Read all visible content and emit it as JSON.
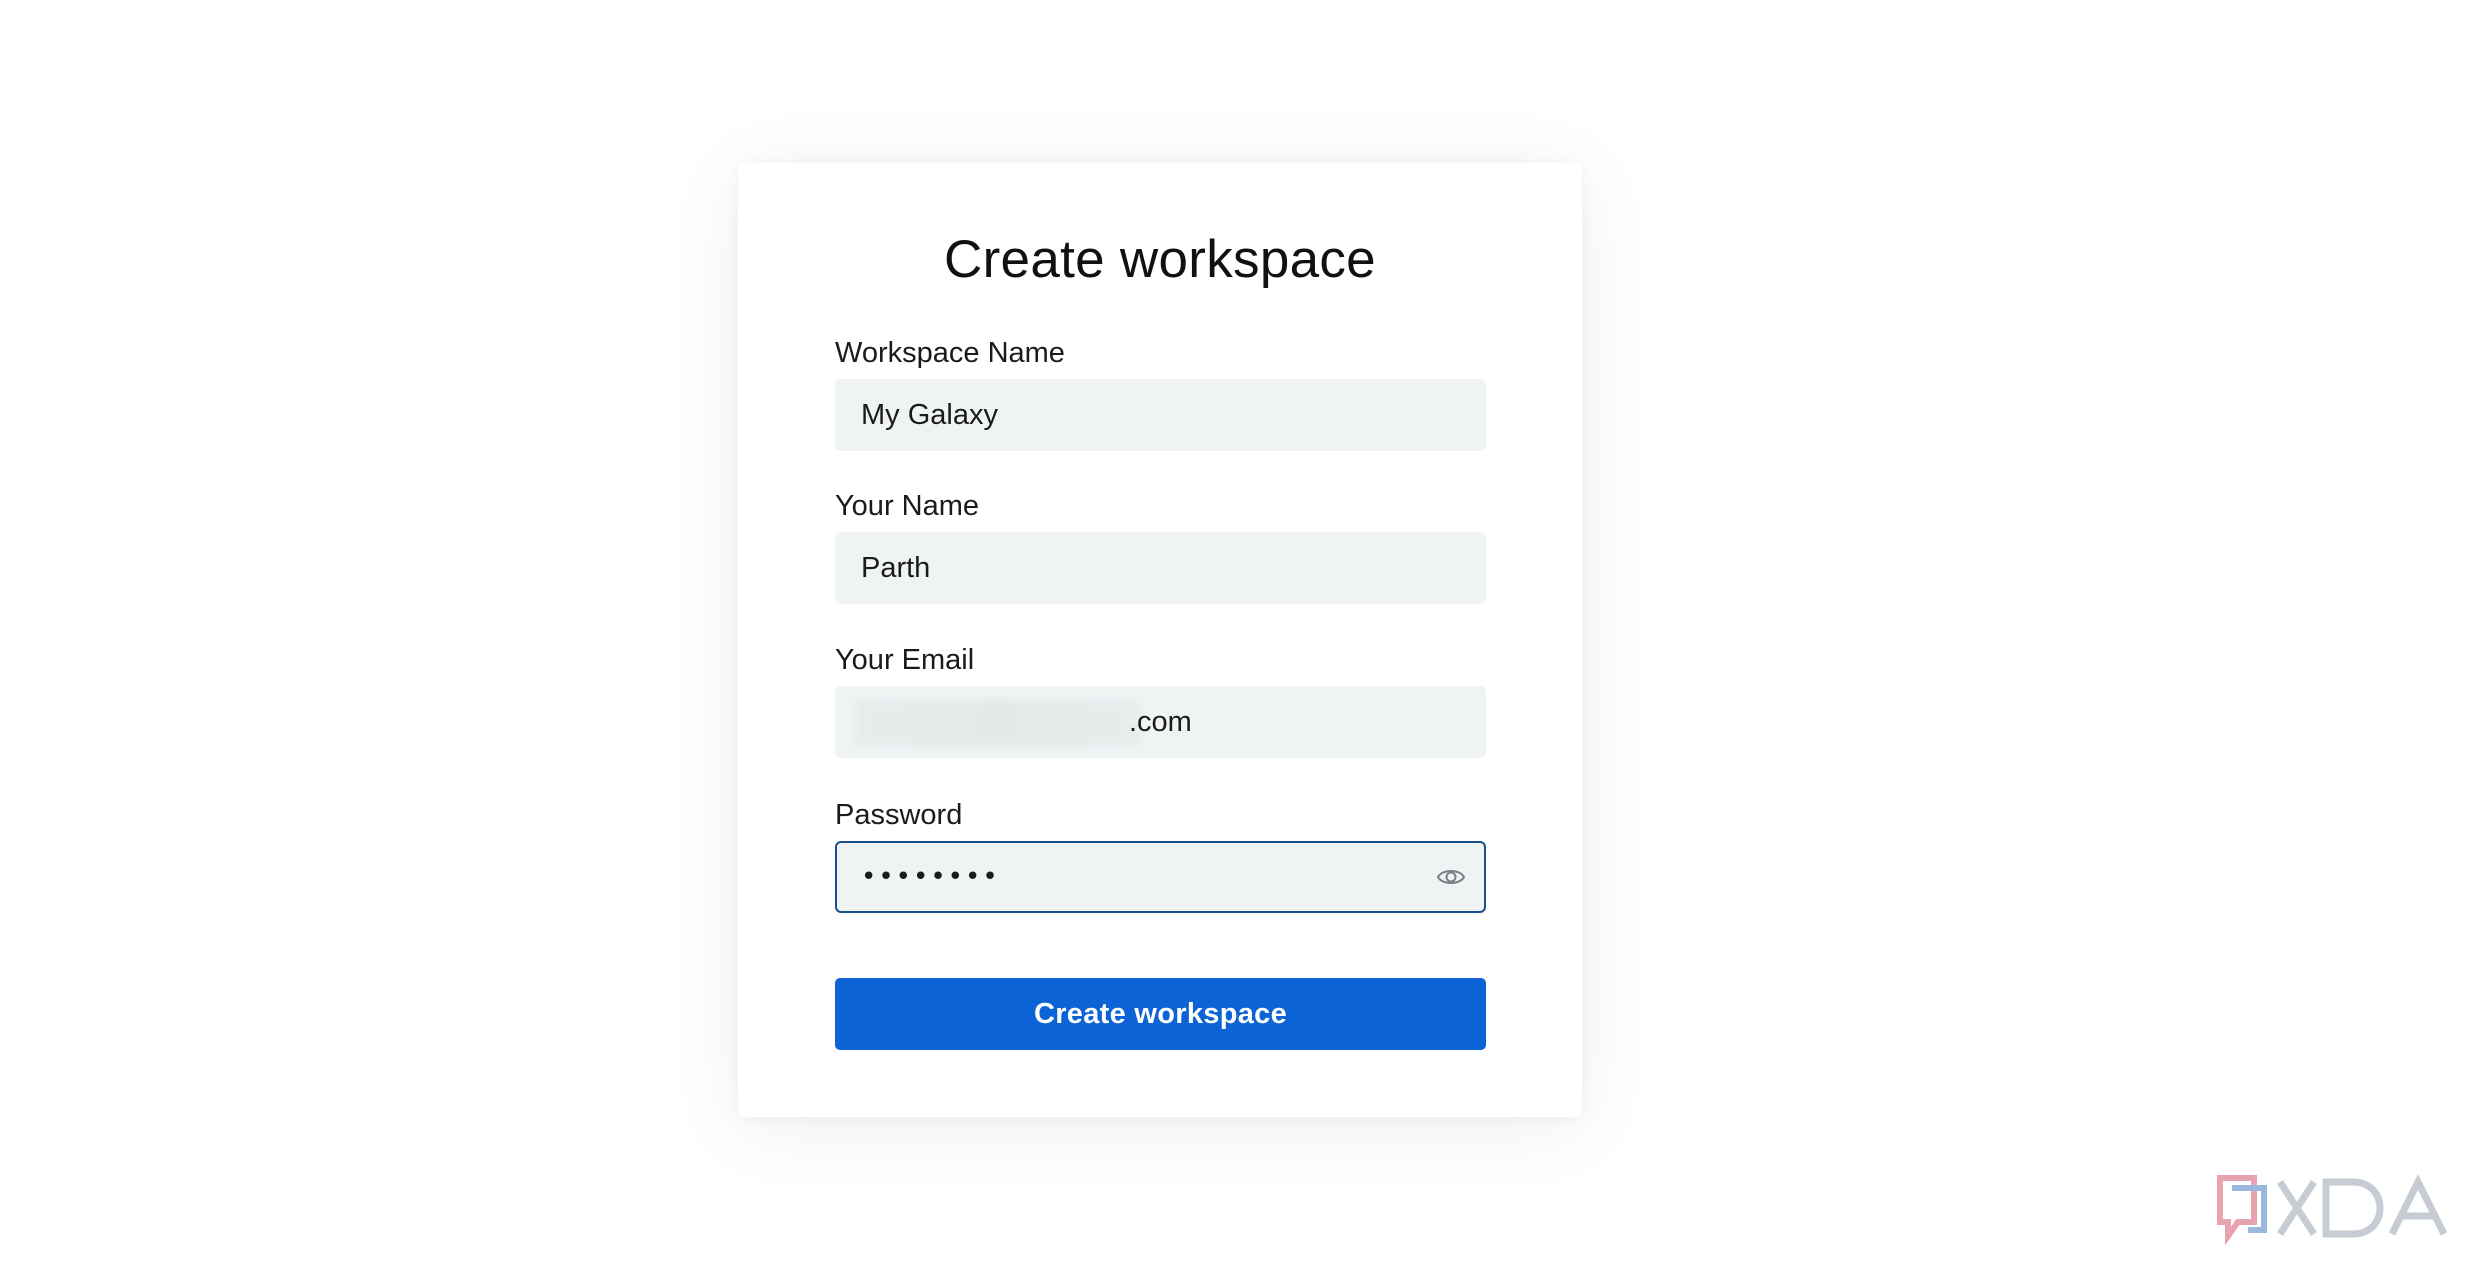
{
  "form": {
    "title": "Create workspace",
    "workspace_name": {
      "label": "Workspace Name",
      "value": "My Galaxy"
    },
    "your_name": {
      "label": "Your Name",
      "value": "Parth"
    },
    "your_email": {
      "label": "Your Email",
      "visible_suffix": ".com"
    },
    "password": {
      "label": "Password",
      "masked_value": "••••••••"
    },
    "submit_label": "Create workspace"
  },
  "watermark": {
    "text": "XDA"
  },
  "colors": {
    "primary_button": "#0b63d6",
    "field_background": "#eff3f4",
    "focus_border": "#1a4f8f"
  },
  "icons": {
    "password_toggle": "eye-icon",
    "watermark": "xda-logo-icon"
  }
}
